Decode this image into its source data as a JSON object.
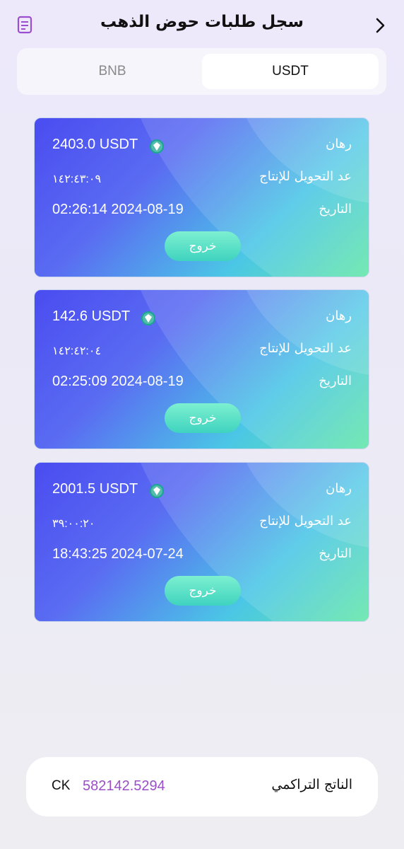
{
  "header": {
    "title": "سجل طلبات حوض الذهب"
  },
  "tabs": [
    {
      "label": "BNB",
      "active": false
    },
    {
      "label": "USDT",
      "active": true
    }
  ],
  "labels": {
    "stake": "رهان",
    "countdown": "عد التحويل للإنتاج",
    "date": "التاريخ",
    "exit": "خروج"
  },
  "orders": [
    {
      "amount": "2403.0 USDT",
      "countdown": "١٤٢:٤٣:٠٩",
      "date": "02:26:14 2024-08-19"
    },
    {
      "amount": "142.6 USDT",
      "countdown": "١٤٢:٤٢:٠٤",
      "date": "02:25:09 2024-08-19"
    },
    {
      "amount": "2001.5 USDT",
      "countdown": "٣٩:٠٠:٢٠",
      "date": "18:43:25 2024-07-24"
    }
  ],
  "footer": {
    "label": "الناتج التراكمي",
    "amount": "582142.5294",
    "unit": "CK"
  },
  "colors": {
    "amount_accent": "#9a4fc7",
    "exit_button": "#3fd3bf"
  },
  "icons": {
    "doc": "document-icon",
    "back": "chevron-right-icon",
    "currency": "usdt-icon"
  }
}
